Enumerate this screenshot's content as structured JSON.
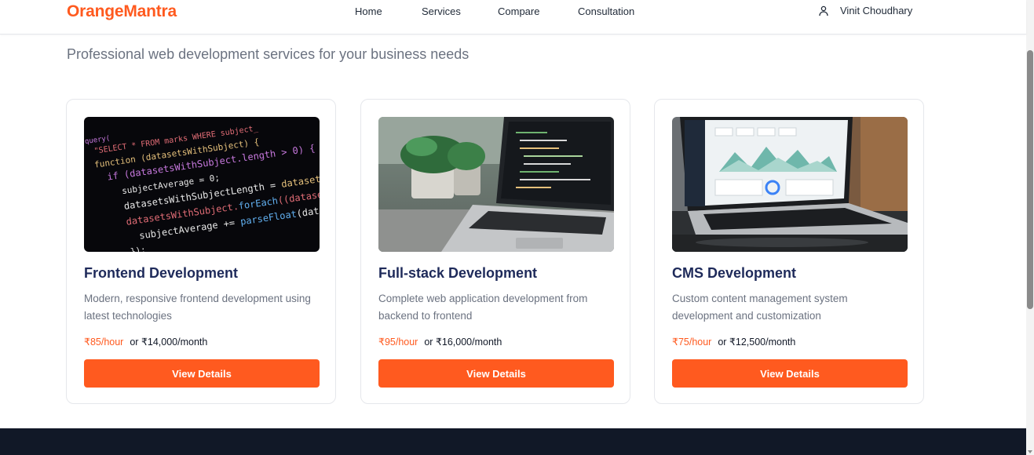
{
  "brand": {
    "name": "OrangeMantra",
    "color": "#ff5a1f"
  },
  "nav": {
    "items": [
      {
        "label": "Home"
      },
      {
        "label": "Services"
      },
      {
        "label": "Compare"
      },
      {
        "label": "Consultation"
      }
    ]
  },
  "user": {
    "name": "Vinit Choudhary",
    "icon": "user-icon"
  },
  "page": {
    "subtitle": "Professional web development services for your business needs"
  },
  "services": [
    {
      "title": "Frontend Development",
      "description": "Modern, responsive frontend development using latest technologies",
      "hourly": "₹85/hour",
      "monthly": "or ₹14,000/month",
      "button": "View Details",
      "image": "code-editor-image"
    },
    {
      "title": "Full-stack Development",
      "description": "Complete web application development from backend to frontend",
      "hourly": "₹95/hour",
      "monthly": "or ₹16,000/month",
      "button": "View Details",
      "image": "laptop-plant-image"
    },
    {
      "title": "CMS Development",
      "description": "Custom content management system development and customization",
      "hourly": "₹75/hour",
      "monthly": "or ₹12,500/month",
      "button": "View Details",
      "image": "laptop-dashboard-image"
    }
  ],
  "colors": {
    "accent": "#ff5a1f",
    "title": "#1e2a5a",
    "footer": "#111827"
  }
}
